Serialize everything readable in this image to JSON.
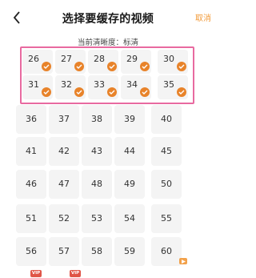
{
  "header": {
    "title": "选择要缓存的视频",
    "cancel_label": "取消"
  },
  "quality": {
    "label": "当前清晰度：标清"
  },
  "accent_color": "#e8832a",
  "selection_color": "#e86aa0",
  "rows": [
    [
      "26",
      "27",
      "28",
      "29",
      "30"
    ],
    [
      "31",
      "32",
      "33",
      "34",
      "35"
    ],
    [
      "36",
      "37",
      "38",
      "39",
      "40"
    ],
    [
      "41",
      "42",
      "43",
      "44",
      "45"
    ],
    [
      "46",
      "47",
      "48",
      "49",
      "50"
    ],
    [
      "51",
      "52",
      "53",
      "54",
      "55"
    ],
    [
      "56",
      "57",
      "58",
      "59",
      "60"
    ]
  ],
  "selected_episodes": [
    "26",
    "27",
    "28",
    "29",
    "30",
    "31",
    "32",
    "33",
    "34",
    "35"
  ],
  "vip_label": "VIP"
}
